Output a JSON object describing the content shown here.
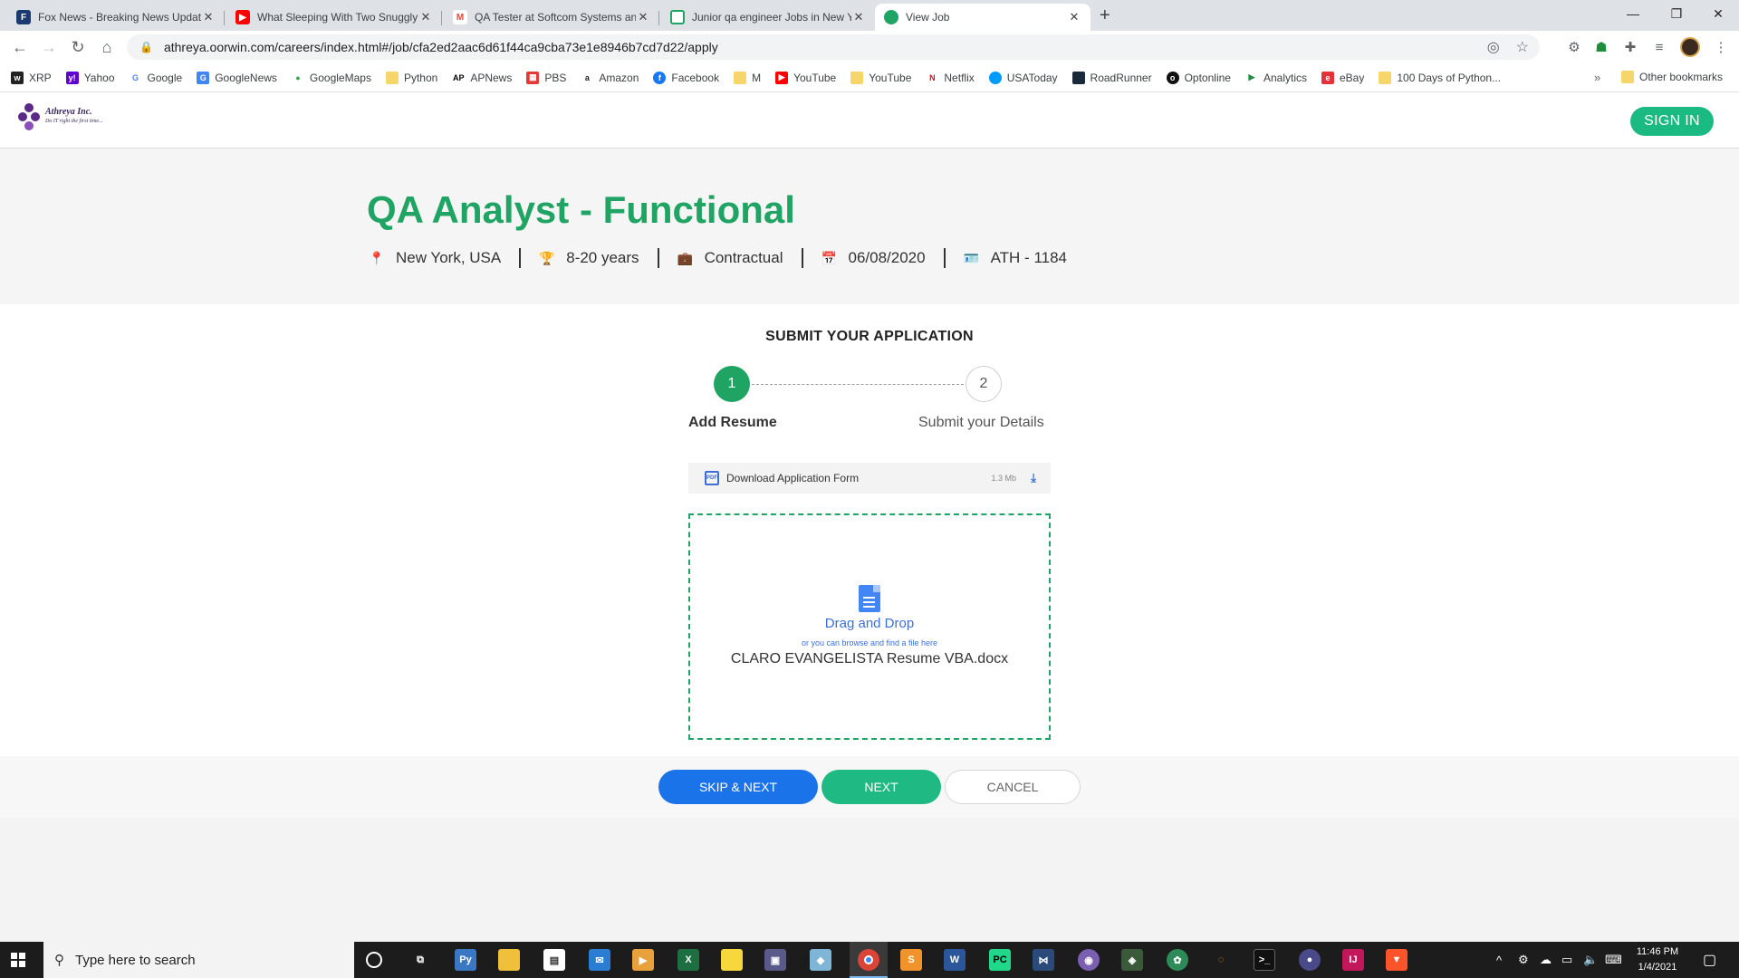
{
  "browser": {
    "tabs": [
      {
        "title": "Fox News - Breaking News Update",
        "favicon": "fox-news",
        "color": "#1b3a70"
      },
      {
        "title": "What Sleeping With Two Snuggly",
        "favicon": "youtube",
        "color": "#ff0000"
      },
      {
        "title": "QA Tester at Softcom Systems and",
        "favicon": "gmail",
        "color": "#ea4335"
      },
      {
        "title": "Junior qa engineer Jobs in New Y",
        "favicon": "doc",
        "color": "#1fa463"
      },
      {
        "title": "View Job",
        "favicon": "oorwin",
        "color": "#1fa463"
      }
    ],
    "new_tab_glyph": "+",
    "url": "athreya.oorwin.com/careers/index.html#/job/cfa2ed2aac6d61f44ca9cba73e1e8946b7cd7d22/apply",
    "bookmarks": [
      {
        "label": "XRP",
        "icon": "xrp",
        "color": "#222222"
      },
      {
        "label": "Yahoo",
        "icon": "yahoo",
        "color": "#6001d2"
      },
      {
        "label": "Google",
        "icon": "google",
        "color": "#4285f4"
      },
      {
        "label": "GoogleNews",
        "icon": "google-news",
        "color": "#4285f4"
      },
      {
        "label": "GoogleMaps",
        "icon": "google-maps",
        "color": "#34a853"
      },
      {
        "label": "Python",
        "icon": "folder",
        "color": "#f6d66b"
      },
      {
        "label": "APNews",
        "icon": "ap",
        "color": "#000000"
      },
      {
        "label": "PBS",
        "icon": "pbs",
        "color": "#e53935"
      },
      {
        "label": "Amazon",
        "icon": "amazon",
        "color": "#222222"
      },
      {
        "label": "Facebook",
        "icon": "facebook",
        "color": "#1877f2"
      },
      {
        "label": "M",
        "icon": "folder",
        "color": "#f6d66b"
      },
      {
        "label": "YouTube",
        "icon": "youtube",
        "color": "#ff0000"
      },
      {
        "label": "YouTube",
        "icon": "folder",
        "color": "#f6d66b"
      },
      {
        "label": "Netflix",
        "icon": "netflix",
        "color": "#e50914"
      },
      {
        "label": "USAToday",
        "icon": "usatoday",
        "color": "#009bff"
      },
      {
        "label": "RoadRunner",
        "icon": "roadrunner",
        "color": "#1a2a3a"
      },
      {
        "label": "Optonline",
        "icon": "optonline",
        "color": "#111111"
      },
      {
        "label": "Analytics",
        "icon": "analytics",
        "color": "#1e8e3e"
      },
      {
        "label": "eBay",
        "icon": "ebay",
        "color": "#e53238"
      },
      {
        "label": "100 Days of Python...",
        "icon": "folder",
        "color": "#f6d66b"
      }
    ],
    "bookmarks_overflow": "»",
    "other_bookmarks": "Other bookmarks"
  },
  "site": {
    "logo_name": "Athreya Inc.",
    "logo_tagline": "Do IT right the first time...",
    "sign_in": "SIGN IN"
  },
  "job": {
    "title": "QA Analyst - Functional",
    "location": "New York, USA",
    "experience": "8-20 years",
    "type": "Contractual",
    "date": "06/08/2020",
    "id": "ATH - 1184"
  },
  "application": {
    "heading": "SUBMIT YOUR APPLICATION",
    "steps": [
      {
        "number": "1",
        "label": "Add Resume"
      },
      {
        "number": "2",
        "label": "Submit your Details"
      }
    ],
    "download_label": "Download Application Form",
    "download_size": "1.3 Mb",
    "dropzone_title": "Drag and Drop",
    "dropzone_sub": "or you can browse and find a file here",
    "file_name": "CLARO EVANGELISTA Resume VBA.docx",
    "buttons": {
      "skip": "SKIP & NEXT",
      "next": "NEXT",
      "cancel": "CANCEL"
    }
  },
  "taskbar": {
    "search_placeholder": "Type here to search",
    "time": "11:46 PM",
    "date": "1/4/2021"
  },
  "colors": {
    "brand_green": "#1fa463",
    "button_blue": "#1a73e8",
    "signin_green": "#1cba83"
  }
}
